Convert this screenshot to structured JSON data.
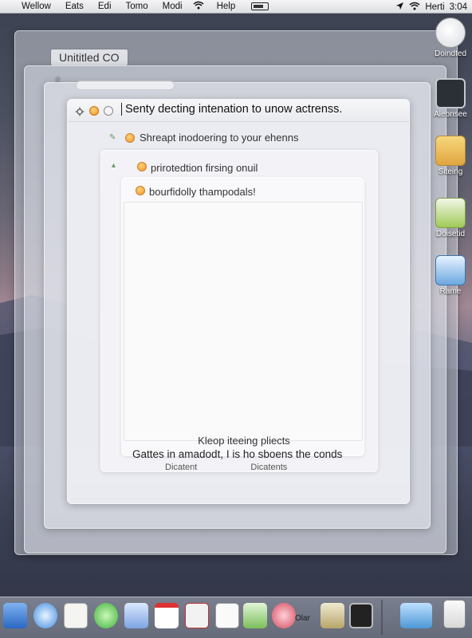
{
  "menubar": {
    "menus": [
      "Wellow",
      "Eats",
      "Edi",
      "Tomo",
      "Modi",
      "Help"
    ],
    "status_right": "Herti",
    "clock": "3:04"
  },
  "background_window": {
    "title": "Unititled CO"
  },
  "main_window": {
    "title": "Senty decting intenation to unow actrenss.",
    "rows": [
      "Shreapt inodoering to your ehenns",
      "prirotedtion firsing onuil",
      "bourfidolly thampodals!"
    ],
    "footer_line1": "Kleop iteeing pliects",
    "footer_line2": "Gattes in amadodt, I is ho sboens the conds",
    "footer_line3_left": "Dicatent",
    "footer_line3_right": "Dicatents"
  },
  "desktop_icons": [
    {
      "label": "Doindted",
      "icon": "safari-like-compass-icon"
    },
    {
      "label": "Aleonsee",
      "icon": "monitor-icon"
    },
    {
      "label": "Siteing",
      "icon": "package-icon"
    },
    {
      "label": "Doisetid",
      "icon": "notes-icon"
    },
    {
      "label": "Rame",
      "icon": "presentation-icon"
    }
  ],
  "dock": {
    "label": "Olar",
    "items": [
      "finder-icon",
      "safari-icon",
      "notes-icon",
      "messages-icon",
      "calendar-icon",
      "calendar2-icon",
      "acrobat-icon",
      "stickies-icon",
      "photos-icon",
      "flower-icon",
      "preview-icon",
      "console-icon",
      "folder-icon",
      "trash-icon"
    ]
  },
  "colors": {
    "traffic_light_orange": "#f0942a",
    "menubar_bg": "#e8e9ec"
  }
}
